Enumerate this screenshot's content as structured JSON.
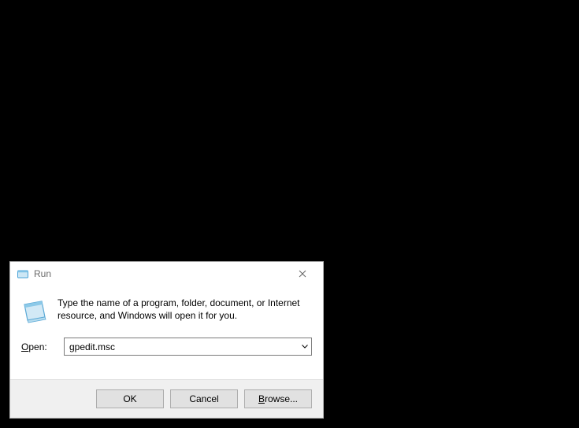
{
  "dialog": {
    "title": "Run",
    "description": "Type the name of a program, folder, document, or Internet resource, and Windows will open it for you.",
    "open_label_pre": "O",
    "open_label_post": "pen:",
    "input_value": "gpedit.msc",
    "buttons": {
      "ok": "OK",
      "cancel": "Cancel",
      "browse_pre": "B",
      "browse_post": "rowse..."
    }
  }
}
